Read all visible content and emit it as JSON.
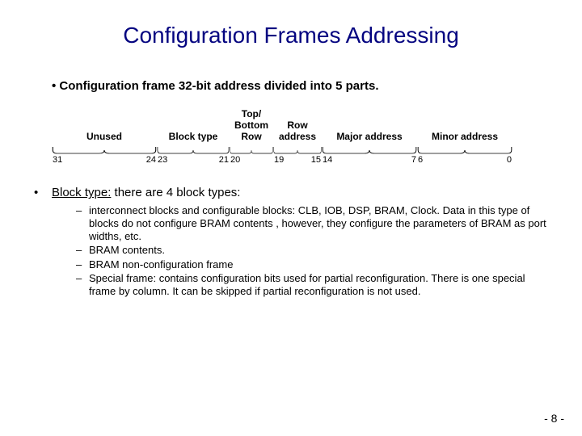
{
  "title": "Configuration Frames Addressing",
  "intro_prefix": "• ",
  "intro_text": "Configuration frame 32-bit address divided into 5 parts.",
  "fields": {
    "unused": {
      "label": "Unused",
      "hi": "31",
      "lo": "24"
    },
    "block": {
      "label": "Block type",
      "hi": "23",
      "lo": "21"
    },
    "topbot": {
      "label_top": "Top/",
      "label_bottom": "Bottom Row",
      "hi": "20",
      "lo": ""
    },
    "row": {
      "label_top": "Row",
      "label_bottom": "address",
      "hi": "19",
      "lo": "15"
    },
    "major": {
      "label": "Major address",
      "hi": "14",
      "lo": "7"
    },
    "minor": {
      "label": "Minor address",
      "hi": "6",
      "lo": "0"
    }
  },
  "body": {
    "lead_label": "Block type:",
    "lead_rest": " there are 4 block types:",
    "items": [
      "interconnect blocks and configurable blocks: CLB, IOB, DSP, BRAM, Clock. Data in this type of blocks do not configure BRAM contents , however, they configure the parameters of BRAM as port widths, etc.",
      "BRAM contents.",
      "BRAM non-configuration frame",
      "Special frame: contains configuration bits used for partial reconfiguration. There is one special frame by column. It can be skipped if partial reconfiguration is not used."
    ]
  },
  "pagenum": "- 8 -"
}
